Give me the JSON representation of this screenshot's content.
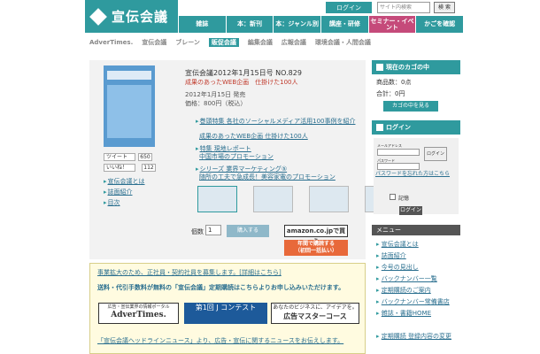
{
  "header": {
    "logo": "宣伝会議",
    "top_link": "ログイン",
    "search_placeholder": "サイト内検索",
    "search_button": "検 索",
    "nav": [
      "雑誌",
      "本：新刊",
      "本：ジャンル別",
      "講座・研修",
      "セミナー・イベント",
      "かごを確認"
    ]
  },
  "subnav": [
    "AdverTimes.",
    "宣伝会議",
    "ブレーン",
    "販促会議",
    "編集会議",
    "広報会議",
    "環境会議・人間会議"
  ],
  "product": {
    "title": "宣伝会議2012年1月15日号 NO.829",
    "subtitle": "成果のあったWEB企画　仕掛けた100人",
    "date": "2012年1月15日 発売",
    "price": "価格：800円（税込）",
    "bullets": [
      {
        "line1": "巻頭特集 各社のソーシャルメディア活用100事例を紹介",
        "line2": "成果のあったWEB企画 仕掛けた100人"
      },
      {
        "line1": "特集 現地レポート",
        "line2": "中国市場のプロモーション"
      },
      {
        "line1": "シリーズ 業界マーケティング⑤",
        "line2": "随所の工夫で急成長！美容家電のプロモーション"
      }
    ],
    "tweet": "ツイート",
    "tweet_count": "650",
    "like": "いいね！",
    "like_count": "112",
    "left_links": [
      "宣伝会議とは",
      "誌面紹介",
      "目次"
    ],
    "qty_label": "個数",
    "qty_value": "1",
    "buy_button": "購入する",
    "amazon": "amazon.co.jpで買う",
    "annual_line1": "年間で購読する",
    "annual_line2": "（初回一括払い）"
  },
  "notice": {
    "line1": "事業拡大のため、正社員・契約社員を募集します。[詳細はこちら]",
    "line2": "送料・代引手数料が無料の「宣伝会議」定期購読はこちらよりお申し込みいただけます。",
    "banner1_top": "広告・宣伝業界の情報ポータル",
    "banner1_main": "AdverTimes.",
    "banner2": "第1回 J コンテスト",
    "banner3_top": "あなたのビジネスに、アイデアを。",
    "banner3_main": "広告マスターコース",
    "line3": "「宣伝会議ヘッドラインニュース」より、広告・宣伝に関するニュースをお伝えします。"
  },
  "sidebar": {
    "cart_title": "現在のカゴの中",
    "cart_items": "商品数：0点",
    "cart_total": "合計：0円",
    "cart_button": "カゴの中を見る",
    "login_title": "ログイン",
    "mail_label": "メールアドレス",
    "pass_label": "パスワード",
    "login_inline": "ログイン",
    "forgot": "パスワードを忘れた方はこちら",
    "remember": "記憶",
    "login_button": "ログイン",
    "menu_title": "メニュー",
    "menu": [
      "宣伝会議とは",
      "誌面紹介",
      "今号の見出し",
      "バックナンバー一覧",
      "定期購読のご案内",
      "バックナンバー常備書店",
      "雑誌・書籍HOME",
      "定期購読 登録内容の変更"
    ]
  }
}
